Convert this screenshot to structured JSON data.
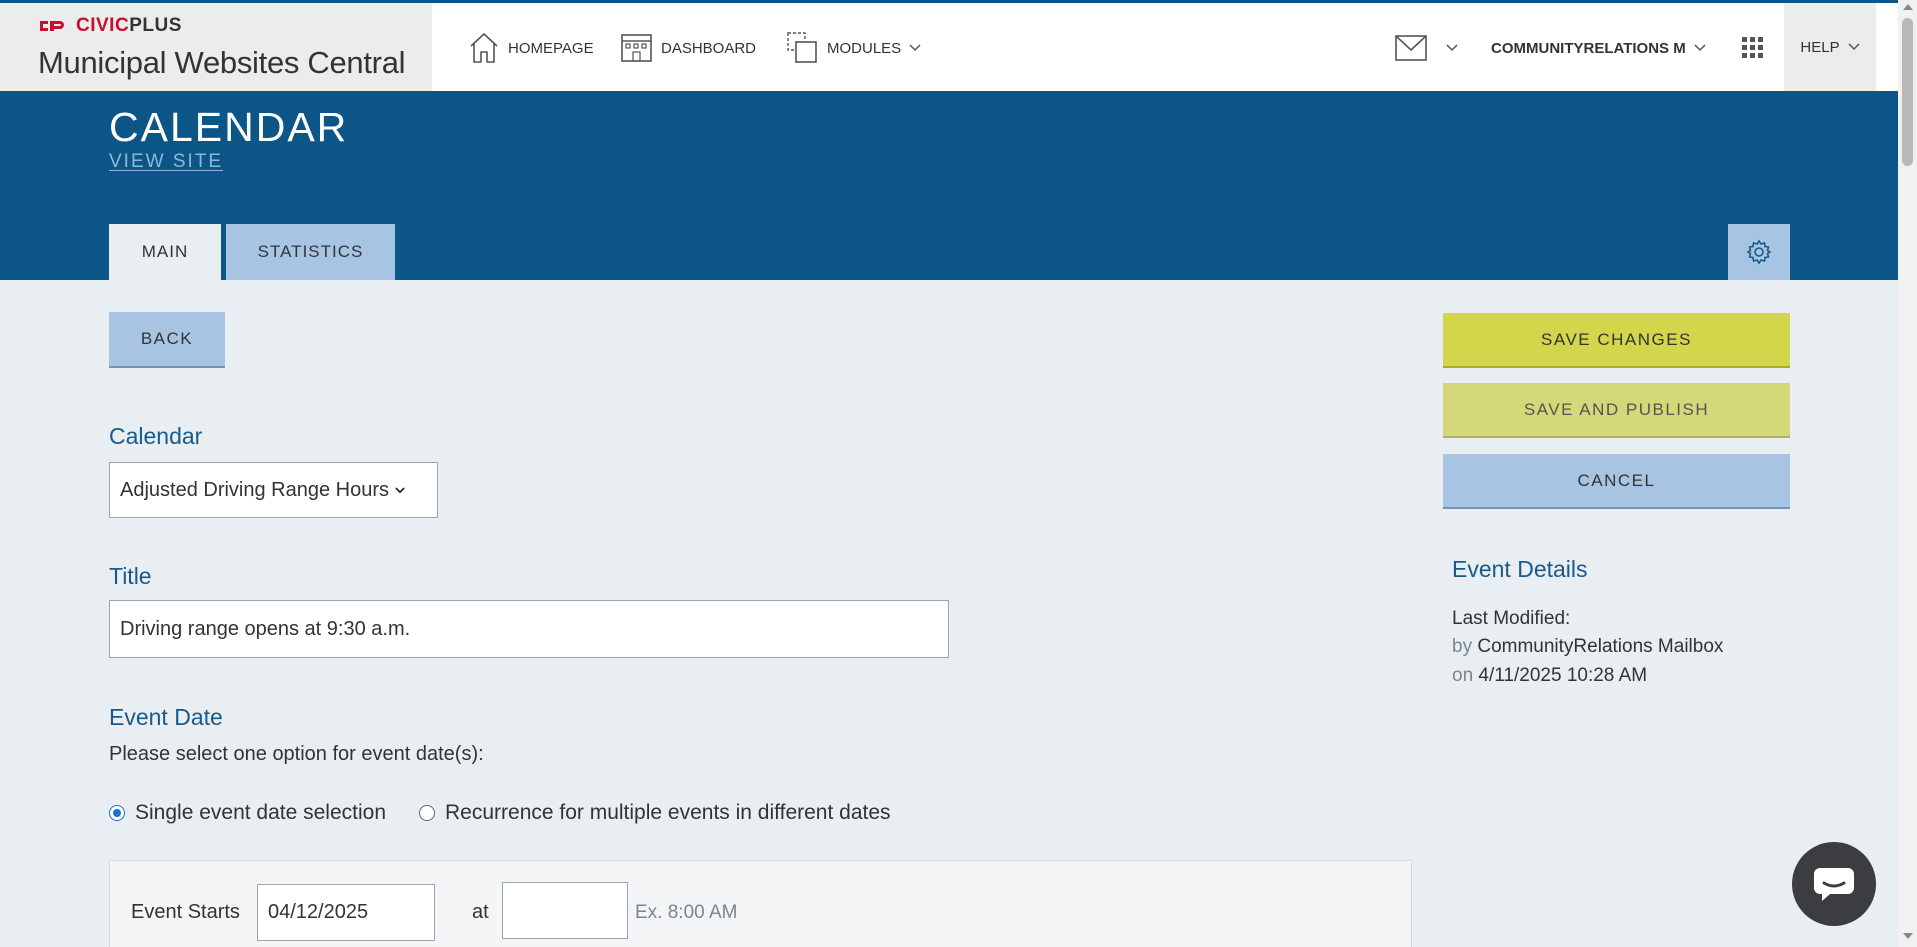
{
  "brand": {
    "logo_civic": "CIVIC",
    "logo_plus": "PLUS",
    "title": "Municipal Websites Central"
  },
  "nav": {
    "homepage": "HOMEPAGE",
    "dashboard": "DASHBOARD",
    "modules": "MODULES",
    "user": "COMMUNITYRELATIONS M",
    "help": "HELP"
  },
  "header": {
    "title": "CALENDAR",
    "view_site": "VIEW SITE",
    "tabs": [
      {
        "label": "MAIN",
        "active": true
      },
      {
        "label": "STATISTICS",
        "active": false
      }
    ]
  },
  "actions": {
    "back": "BACK",
    "save_changes": "SAVE CHANGES",
    "save_publish": "SAVE AND PUBLISH",
    "cancel": "CANCEL"
  },
  "form": {
    "calendar_label": "Calendar",
    "calendar_value": "Adjusted Driving Range Hours",
    "title_label": "Title",
    "title_value": "Driving range opens at 9:30 a.m.",
    "event_date_label": "Event Date",
    "event_date_helper": "Please select one option for event date(s):",
    "radio_single": "Single event date selection",
    "radio_recurrence": "Recurrence for multiple events in different dates",
    "single_selected": true,
    "event_starts_label": "Event Starts",
    "event_starts_value": "04/12/2025",
    "at_label": "at",
    "time_value": "",
    "time_hint": "Ex. 8:00 AM"
  },
  "details": {
    "title": "Event Details",
    "last_modified_label": "Last Modified:",
    "by_label": "by",
    "by_value": "CommunityRelations Mailbox",
    "on_label": "on",
    "on_value": "4/11/2025 10:28 AM"
  },
  "colors": {
    "header_blue": "#0c5587",
    "tab_blue": "#a7c4e3",
    "save_yellow": "#d3d64a",
    "label_blue": "#1a5a8a",
    "brand_red": "#c8102e"
  },
  "icons": {
    "homepage": "house-icon",
    "dashboard": "building-icon",
    "modules": "modules-icon",
    "mail": "mail-icon",
    "apps": "grid-icon",
    "settings": "gear-icon",
    "chat": "chat-icon"
  }
}
